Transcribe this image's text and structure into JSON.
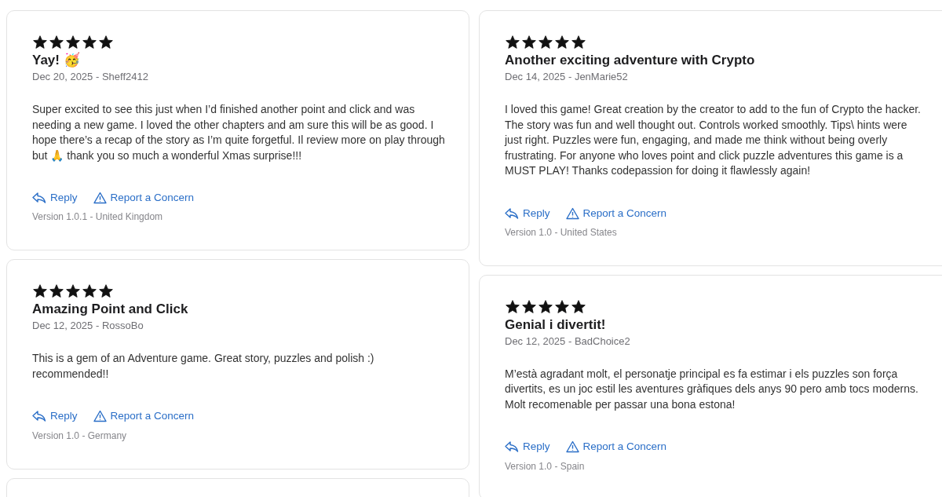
{
  "columns": [
    {
      "reviews": [
        {
          "stars": 5,
          "title": "Yay! 🥳",
          "meta": "Dec 20, 2025 - Sheff2412",
          "body": "Super excited to see this just when I’d finished another point and click and was needing a new game. I loved the other chapters and am sure this will be as good. I hope there’s a recap of the story as I’m quite forgetful. Il review more on play through but 🙏 thank you so much a wonderful Xmas surprise!!!",
          "reply": "Reply",
          "report": "Report a Concern",
          "version": "Version 1.0.1 - United Kingdom"
        },
        {
          "stars": 5,
          "title": "Amazing Point and Click",
          "meta": "Dec 12, 2025 - RossoBo",
          "body": "This is a gem of an Adventure game. Great story, puzzles and polish :) recommended!!",
          "reply": "Reply",
          "report": "Report a Concern",
          "version": "Version 1.0 - Germany"
        }
      ]
    },
    {
      "reviews": [
        {
          "stars": 5,
          "title": "Another exciting adventure with Crypto",
          "meta": "Dec 14, 2025 - JenMarie52",
          "body": "I loved this game! Great creation by the creator to add to the fun of Crypto the hacker. The story was fun and well thought out. Controls worked smoothly. Tips\\ hints were just right. Puzzles were fun, engaging, and made me think without being overly frustrating. For anyone who loves point and click puzzle adventures this game is a MUST PLAY! Thanks codepassion for doing it flawlessly again!",
          "reply": "Reply",
          "report": "Report a Concern",
          "version": "Version 1.0 - United States"
        },
        {
          "stars": 5,
          "title": "Genial i divertit!",
          "meta": "Dec 12, 2025 - BadChoice2",
          "body": "M’està agradant molt, el personatje principal es fa estimar i els puzzles son força divertits, es un joc estil les aventures gràfiques dels anys 90 pero amb tocs moderns. Molt recomenable per passar una bona estona!",
          "reply": "Reply",
          "report": "Report a Concern",
          "version": "Version 1.0 - Spain"
        }
      ]
    }
  ]
}
